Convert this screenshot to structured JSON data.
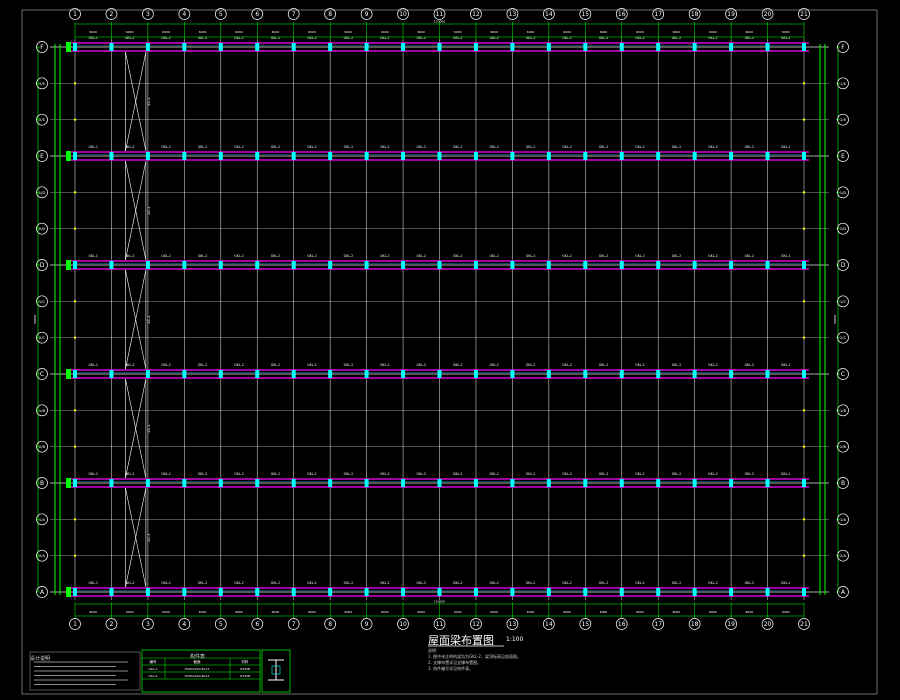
{
  "drawing": {
    "title": "屋面梁布置图",
    "scale": "1:100",
    "colors": {
      "background": "#000000",
      "gridline": "#ffffff",
      "axis_bubble": "#ffffff",
      "beam": "#ff00ff",
      "beam_inner": "#00bfff",
      "dimension": "#00ff00",
      "column": "#00ffff",
      "bracing": "#ffffff",
      "note_text": "#cccccc"
    },
    "column_axes": [
      "1",
      "2",
      "3",
      "4",
      "5",
      "6",
      "7",
      "8",
      "9",
      "10",
      "11",
      "12",
      "13",
      "14",
      "15",
      "16",
      "17",
      "18",
      "19",
      "20",
      "21"
    ],
    "row_axes": [
      "F",
      "1/E",
      "2/E",
      "E",
      "1/D",
      "2/D",
      "D",
      "1/C",
      "2/C",
      "C",
      "1/B",
      "2/B",
      "B",
      "1/A",
      "2/A",
      "A"
    ],
    "main_rows": [
      "F",
      "E",
      "D",
      "C",
      "B",
      "A"
    ],
    "beam_rows": [
      {
        "row": "F",
        "labels": [
          "GKL-1",
          "GKL-2",
          "GKL-2",
          "GKL-2",
          "GKL-2",
          "GKL-2",
          "GKL-2",
          "GKL-2",
          "GKL-2",
          "GKL-2",
          "GKL-2",
          "GKL-2",
          "GKL-2",
          "GKL-2",
          "GKL-2",
          "GKL-2",
          "GKL-2",
          "GKL-2",
          "GKL-2",
          "GKL-1"
        ]
      },
      {
        "row": "E",
        "labels": [
          "GKL-1",
          "GKL-2",
          "GKL-2",
          "GKL-2",
          "GKL-2",
          "GKL-2",
          "GKL-2",
          "GKL-2",
          "GKL-2",
          "GKL-2",
          "GKL-2",
          "GKL-2",
          "GKL-2",
          "GKL-2",
          "GKL-2",
          "GKL-2",
          "GKL-2",
          "GKL-2",
          "GKL-2",
          "GKL-1"
        ]
      },
      {
        "row": "D",
        "labels": [
          "GKL-1",
          "GKL-2",
          "GKL-2",
          "GKL-2",
          "GKL-2",
          "GKL-2",
          "GKL-2",
          "GKL-2",
          "GKL-2",
          "GKL-2",
          "GKL-2",
          "GKL-2",
          "GKL-2",
          "GKL-2",
          "GKL-2",
          "GKL-2",
          "GKL-2",
          "GKL-2",
          "GKL-2",
          "GKL-1"
        ]
      },
      {
        "row": "C",
        "labels": [
          "GKL-1",
          "GKL-2",
          "GKL-2",
          "GKL-2",
          "GKL-2",
          "GKL-2",
          "GKL-2",
          "GKL-2",
          "GKL-2",
          "GKL-2",
          "GKL-2",
          "GKL-2",
          "GKL-2",
          "GKL-2",
          "GKL-2",
          "GKL-2",
          "GKL-2",
          "GKL-2",
          "GKL-2",
          "GKL-1"
        ]
      },
      {
        "row": "B",
        "labels": [
          "GKL-1",
          "GKL-2",
          "GKL-2",
          "GKL-2",
          "GKL-2",
          "GKL-2",
          "GKL-2",
          "GKL-2",
          "GKL-2",
          "GKL-2",
          "GKL-2",
          "GKL-2",
          "GKL-2",
          "GKL-2",
          "GKL-2",
          "GKL-2",
          "GKL-2",
          "GKL-2",
          "GKL-2",
          "GKL-1"
        ]
      },
      {
        "row": "A",
        "labels": [
          "GKL-1",
          "GKL-2",
          "GKL-2",
          "GKL-2",
          "GKL-2",
          "GKL-2",
          "GKL-2",
          "GKL-2",
          "GKL-2",
          "GKL-2",
          "GKL-2",
          "GKL-2",
          "GKL-2",
          "GKL-2",
          "GKL-2",
          "GKL-2",
          "GKL-2",
          "GKL-2",
          "GKL-2",
          "GKL-1"
        ]
      }
    ],
    "bay_dimensions": [
      "6000",
      "6000",
      "6000",
      "6000",
      "6000",
      "6000",
      "6000",
      "6000",
      "6000",
      "6000",
      "6000",
      "6000",
      "6000",
      "6000",
      "6000",
      "6000",
      "6000",
      "6000",
      "6000",
      "6000"
    ],
    "overall_dimension": "120000",
    "side_dimension": "50000",
    "bracing_labels": [
      "ZC-1",
      "ZC-1",
      "ZC-1",
      "ZC-1",
      "ZC-1"
    ],
    "notes": [
      "说明：",
      "1. 图中未注明的梁均为GKL-2，梁顶标高见剖面图。",
      "2. 支撑布置详见支撑布置图。",
      "3. 构件编号详见构件表。"
    ],
    "table": {
      "title": "构件表",
      "headers": [
        "编号",
        "截面",
        "材料"
      ],
      "rows": [
        [
          "GKL-1",
          "H400x200x8x12",
          "Q345B"
        ],
        [
          "GKL-2",
          "H400x200x8x12",
          "Q345B"
        ]
      ]
    },
    "legend_title": "设计说明"
  }
}
